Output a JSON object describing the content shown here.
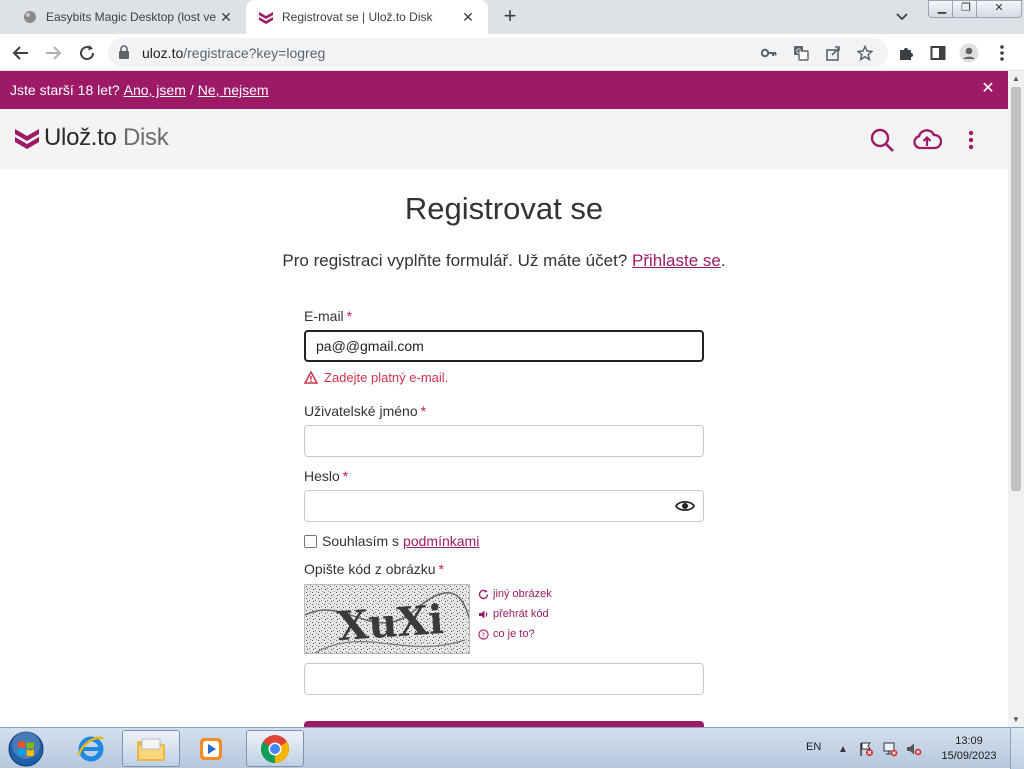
{
  "browser": {
    "tabs": [
      {
        "title": "Easybits Magic Desktop (lost vers",
        "active": false
      },
      {
        "title": "Registrovat se | Ulož.to Disk",
        "active": true
      }
    ],
    "url_host": "uloz.to",
    "url_path": "/registrace?key=logreg"
  },
  "age_bar": {
    "question": "Jste starší 18 let?",
    "yes": "Ano, jsem",
    "separator": "/",
    "no": "Ne, nejsem"
  },
  "header": {
    "logo_brand": "Ulož.to",
    "logo_product": "Disk",
    "accent_color": "#9c1a66"
  },
  "page": {
    "title": "Registrovat se",
    "subtitle_text": "Pro registraci vyplňte formulář. Už máte účet?",
    "login_link": "Přihlaste se",
    "subtitle_end": "."
  },
  "form": {
    "email_label": "E-mail",
    "email_value": "pa@@gmail.com",
    "email_error": "Zadejte platný e-mail.",
    "username_label": "Uživatelské jméno",
    "username_value": "",
    "password_label": "Heslo",
    "password_value": "",
    "consent_text": "Souhlasím s",
    "consent_link": "podmínkami",
    "captcha_label": "Opište kód z obrázku",
    "captcha_text": "XuXi",
    "captcha_new": "jiný obrázek",
    "captcha_play": "přehrát kód",
    "captcha_help": "co je to?",
    "captcha_value": "",
    "required_mark": "*"
  },
  "taskbar": {
    "language": "EN",
    "time": "13:09",
    "date": "15/09/2023"
  }
}
